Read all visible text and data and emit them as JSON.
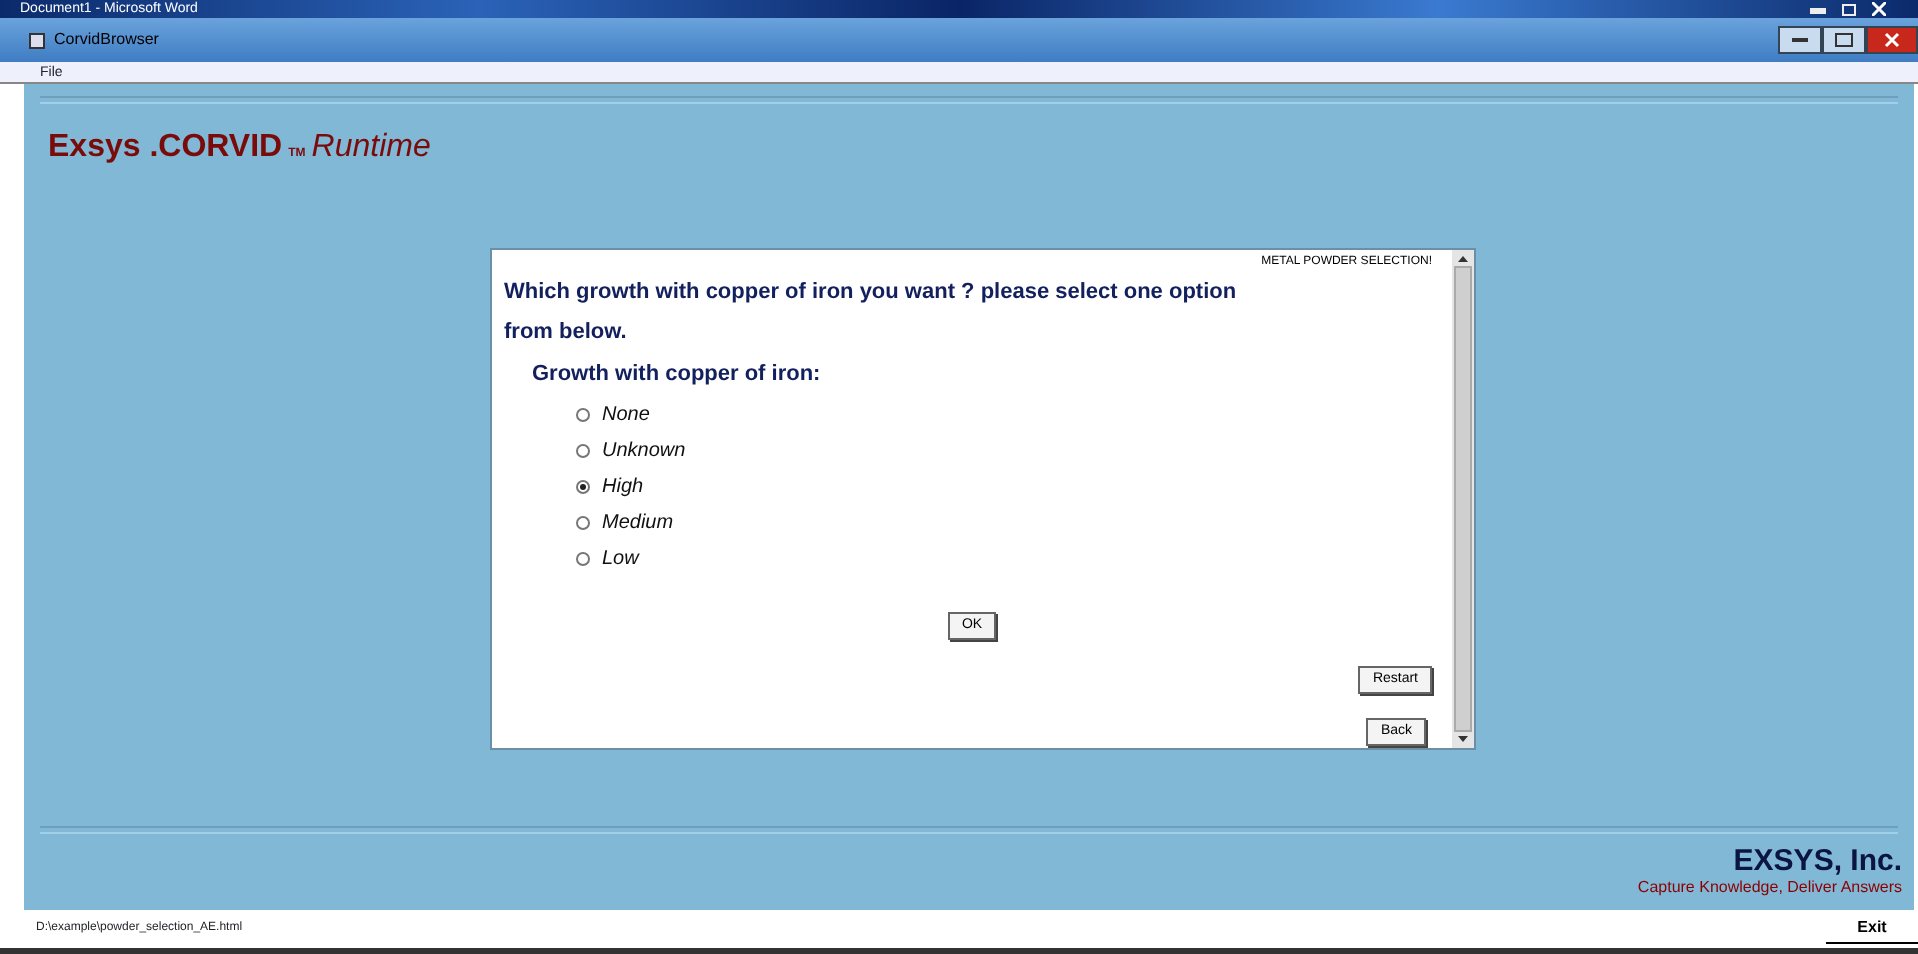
{
  "outer_window": {
    "title": "Document1 - Microsoft Word"
  },
  "window": {
    "title": "CorvidBrowser"
  },
  "menu": [
    "File"
  ],
  "header": {
    "brand": "Exsys",
    "product": ".CORVID",
    "tm": "TM",
    "suffix": "Runtime"
  },
  "panel": {
    "section_title": "METAL POWDER SELECTION!",
    "question": "Which growth with copper of iron you want ? please select one option from below.",
    "variable": "Growth with copper of iron:",
    "options": [
      {
        "label": "None",
        "selected": false
      },
      {
        "label": "Unknown",
        "selected": false
      },
      {
        "label": "High",
        "selected": true
      },
      {
        "label": "Medium",
        "selected": false
      },
      {
        "label": "Low",
        "selected": false
      }
    ],
    "ok_button": "OK",
    "restart_button": "Restart",
    "back_button": "Back"
  },
  "footer": {
    "company": "EXSYS, Inc.",
    "tagline": "Capture Knowledge, Deliver Answers"
  },
  "status_bar": {
    "path": "D:\\example\\powder_selection_AE.html",
    "exit_button": "Exit"
  }
}
